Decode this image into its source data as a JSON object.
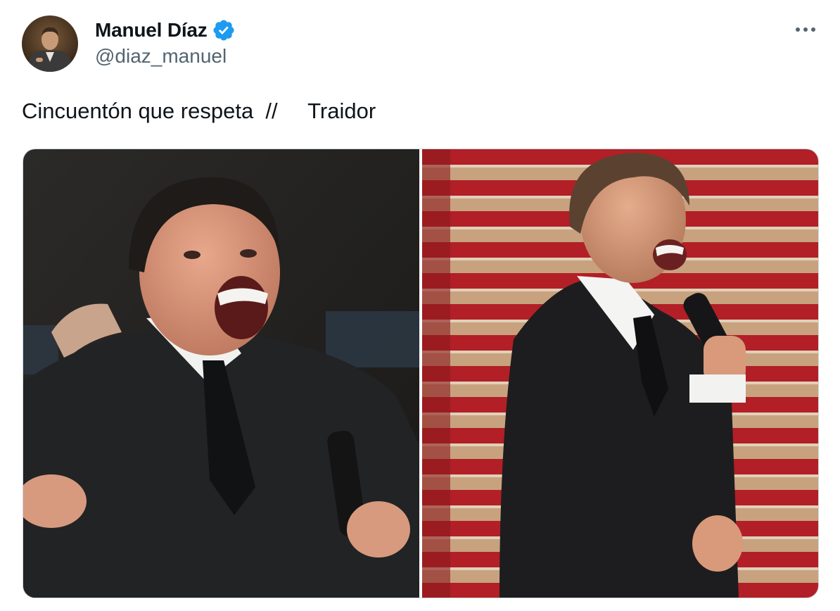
{
  "author": {
    "display_name": "Manuel Díaz",
    "handle": "@diaz_manuel",
    "verified": true
  },
  "tweet": {
    "text": "Cincuentón que respeta  //     Traidor"
  },
  "icons": {
    "verified": "verified-badge-icon",
    "more": "more-options-icon"
  },
  "colors": {
    "verified_blue": "#1d9bf0",
    "text_primary": "#0f1419",
    "text_secondary": "#536471",
    "border": "#cfd9de"
  }
}
